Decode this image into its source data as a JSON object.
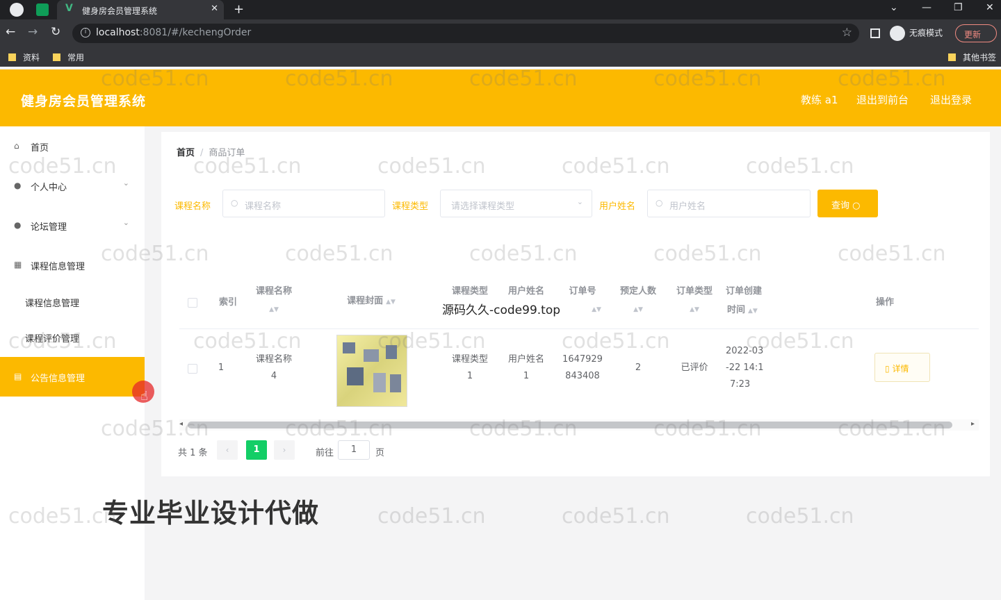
{
  "browser": {
    "tab_title": "健身房会员管理系统",
    "url_host": "localhost",
    "url_rest": ":8081/#/kechengOrder",
    "incognito_label": "无痕模式",
    "update_label": "更新",
    "bookmarks": [
      "资料",
      "常用"
    ],
    "other_bookmarks": "其他书签"
  },
  "header": {
    "title": "健身房会员管理系统",
    "user_label": "教练 a1",
    "back_front_label": "退出到前台",
    "logout_label": "退出登录",
    "brand_color": "#fcb900"
  },
  "sidebar": {
    "items": [
      {
        "label": "首页",
        "icon": "home-icon"
      },
      {
        "label": "个人中心",
        "icon": "user-icon"
      },
      {
        "label": "论坛管理",
        "icon": "bulb-icon"
      },
      {
        "label": "课程信息管理",
        "icon": "grid-icon"
      },
      {
        "label": "课程信息管理"
      },
      {
        "label": "课程评价管理"
      },
      {
        "label": "公告信息管理",
        "icon": "doc-icon",
        "active": true
      }
    ]
  },
  "breadcrumb": {
    "home": "首页",
    "current": "商品订单"
  },
  "search": {
    "course_name_label": "课程名称",
    "course_name_placeholder": "课程名称",
    "course_type_label": "课程类型",
    "course_type_placeholder": "请选择课程类型",
    "user_name_label": "用户姓名",
    "user_name_placeholder": "用户姓名",
    "query_label": "查询"
  },
  "table": {
    "columns": {
      "index": "索引",
      "course_name": "课程名称",
      "cover": "课程封面",
      "course_type": "课程类型",
      "user_name": "用户姓名",
      "order_no": "订单号",
      "reserve_count": "预定人数",
      "order_type": "订单类型",
      "created_line1": "订单创建",
      "created_line2": "时间",
      "actions": "操作"
    },
    "rows": [
      {
        "index": "1",
        "course_name_1": "课程名称",
        "course_name_2": "4",
        "course_type_1": "课程类型",
        "course_type_2": "1",
        "user_name_1": "用户姓名",
        "user_name_2": "1",
        "order_no_1": "1647929",
        "order_no_2": "843408",
        "reserve_count": "2",
        "order_type": "已评价",
        "created_1": "2022-03",
        "created_2": "-22 14:1",
        "created_3": "7:23",
        "detail_label": "详情"
      }
    ]
  },
  "pagination": {
    "total": "共 1 条",
    "current_page": "1",
    "goto_label": "前往",
    "goto_value": "1",
    "page_suffix": "页",
    "active_color": "#13ce66"
  },
  "overlays": {
    "code_text": "源码久久-code99.top",
    "ad_text": "专业毕业设计代做",
    "watermark": "code51.cn"
  }
}
